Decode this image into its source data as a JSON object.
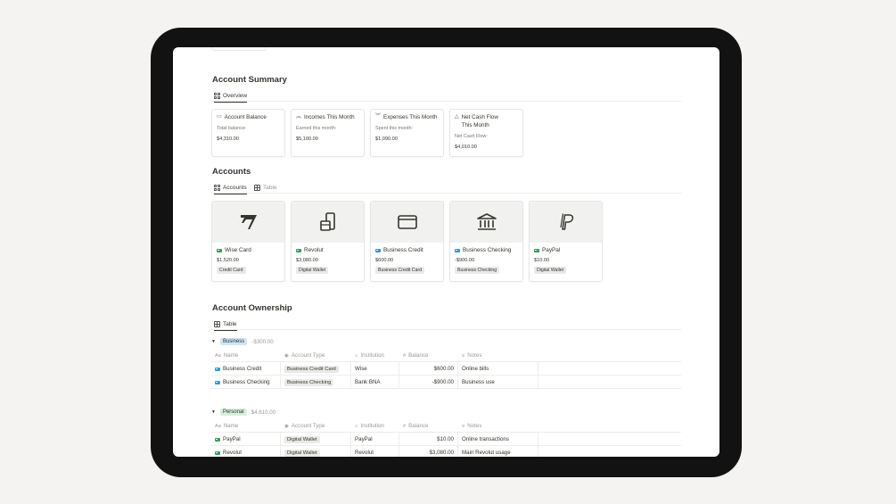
{
  "sections": {
    "summary_title": "Account Summary",
    "summary_tab": "Overview",
    "accounts_title": "Accounts",
    "accounts_tab_1": "Accounts",
    "accounts_tab_2": "Table",
    "ownership_title": "Account Ownership",
    "ownership_tab": "Table"
  },
  "summary_cards": [
    {
      "title": "Account Balance",
      "icon": "wallet-icon",
      "label": "Total balance:",
      "value": "$4,310.00"
    },
    {
      "title": "Incomes This Month",
      "icon": "double-chevron-up-icon",
      "label": "Earned this month:",
      "value": "$5,100.00"
    },
    {
      "title": "Expenses This Month",
      "icon": "double-chevron-down-icon",
      "label": "Spent this month:",
      "value": "$1,090.00"
    },
    {
      "title": "Net Cash Flow This Month",
      "icon": "triangle-icon",
      "label": "Net Cash Flow:",
      "value": "$4,010.00"
    }
  ],
  "account_cards": [
    {
      "name": "Wise Card",
      "balance": "$1,520.00",
      "type": "Credit Card",
      "logo": "wise-logo-icon",
      "icon_color": "green"
    },
    {
      "name": "Revolut",
      "balance": "$3,080.00",
      "type": "Digital Wallet",
      "logo": "revolut-phone-icon",
      "icon_color": "green"
    },
    {
      "name": "Business Credit",
      "balance": "$600.00",
      "type": "Business Credit Card",
      "logo": "credit-card-icon",
      "icon_color": "blue"
    },
    {
      "name": "Business Checking",
      "balance": "-$900.00",
      "type": "Business Checking",
      "logo": "bank-icon",
      "icon_color": "blue"
    },
    {
      "name": "PayPal",
      "balance": "$10.00",
      "type": "Digital Wallet",
      "logo": "paypal-logo-icon",
      "icon_color": "green"
    }
  ],
  "table_headers": {
    "name": "Name",
    "type": "Account Type",
    "institution": "Institution",
    "balance": "Balance",
    "notes": "Notes",
    "name_prefix": "Aa",
    "balance_prefix": "#"
  },
  "groups": [
    {
      "label": "Business",
      "sum": "-$300.00",
      "color": "blue",
      "rows": [
        {
          "name": "Business Credit",
          "type": "Business Credit Card",
          "institution": "Wise",
          "balance": "$600.00",
          "notes": "Online bills"
        },
        {
          "name": "Business Checking",
          "type": "Business Checking",
          "institution": "Bank BNA",
          "balance": "-$900.00",
          "notes": "Business use"
        }
      ]
    },
    {
      "label": "Personal",
      "sum": "$4,610.00",
      "color": "green",
      "rows": [
        {
          "name": "PayPal",
          "type": "Digital Wallet",
          "institution": "PayPal",
          "balance": "$10.00",
          "notes": "Online transactions"
        },
        {
          "name": "Revolut",
          "type": "Digital Wallet",
          "institution": "Revolut",
          "balance": "$3,080.00",
          "notes": "Main Revolut usage"
        }
      ]
    }
  ],
  "colors": {
    "device": "#121212",
    "background": "#f4f3f1",
    "blue_tag": "#d3e5ef",
    "green_tag": "#dbeddb"
  }
}
